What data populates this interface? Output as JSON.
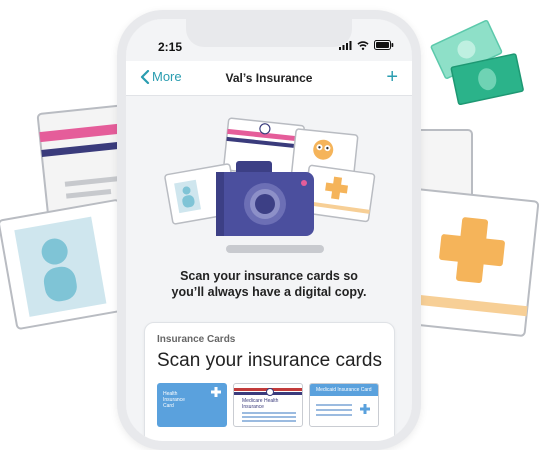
{
  "status": {
    "time": "2:15"
  },
  "nav": {
    "back_label": "More",
    "title": "Val’s Insurance",
    "add_symbol": "+"
  },
  "message": {
    "line1": "Scan your insurance cards so",
    "line2": "you’ll always have a digital copy."
  },
  "panel": {
    "label": "Insurance Cards",
    "title": "Scan your insurance cards",
    "cards": [
      {
        "label": "Health Insurance Card"
      },
      {
        "label": "Medicare Health Insurance"
      },
      {
        "label": "Medicaid Insurance Card"
      }
    ]
  },
  "colors": {
    "accent": "#2a9db0",
    "camera": "#4b4f9e",
    "cross": "#f5b45a",
    "money": "#2bb38a"
  }
}
